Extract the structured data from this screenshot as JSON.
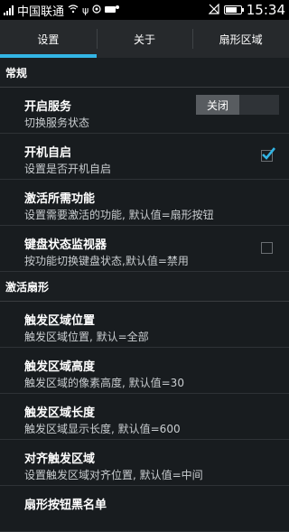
{
  "status_bar": {
    "carrier": "中国联通",
    "time": "15:34",
    "battery_level": 0.75
  },
  "tabs": [
    {
      "label": "设置",
      "active": true
    },
    {
      "label": "关于",
      "active": false
    },
    {
      "label": "扇形区域",
      "active": false
    }
  ],
  "sections": {
    "general": {
      "header": "常规",
      "items": [
        {
          "title": "开启服务",
          "subtitle": "切换服务状态",
          "toggle_label": "关闭"
        },
        {
          "title": "开机自启",
          "subtitle": "设置是否开机自启",
          "checked": true
        },
        {
          "title": "激活所需功能",
          "subtitle": "设置需要激活的功能, 默认值=扇形按钮"
        },
        {
          "title": "键盘状态监视器",
          "subtitle": "按功能切换键盘状态,默认值=禁用",
          "checked": false
        }
      ]
    },
    "activate": {
      "header": "激活扇形",
      "items": [
        {
          "title": "触发区域位置",
          "subtitle": "触发区域位置, 默认=全部"
        },
        {
          "title": "触发区域高度",
          "subtitle": "触发区域的像素高度, 默认值=30"
        },
        {
          "title": "触发区域长度",
          "subtitle": "触发区域显示长度, 默认值=600"
        },
        {
          "title": "对齐触发区域",
          "subtitle": "设置触发区域对齐位置, 默认值=中间"
        },
        {
          "title": "扇形按钮黑名单",
          "subtitle": ""
        }
      ]
    }
  },
  "colors": {
    "accent": "#33b5e5",
    "background": "#181c1f"
  }
}
